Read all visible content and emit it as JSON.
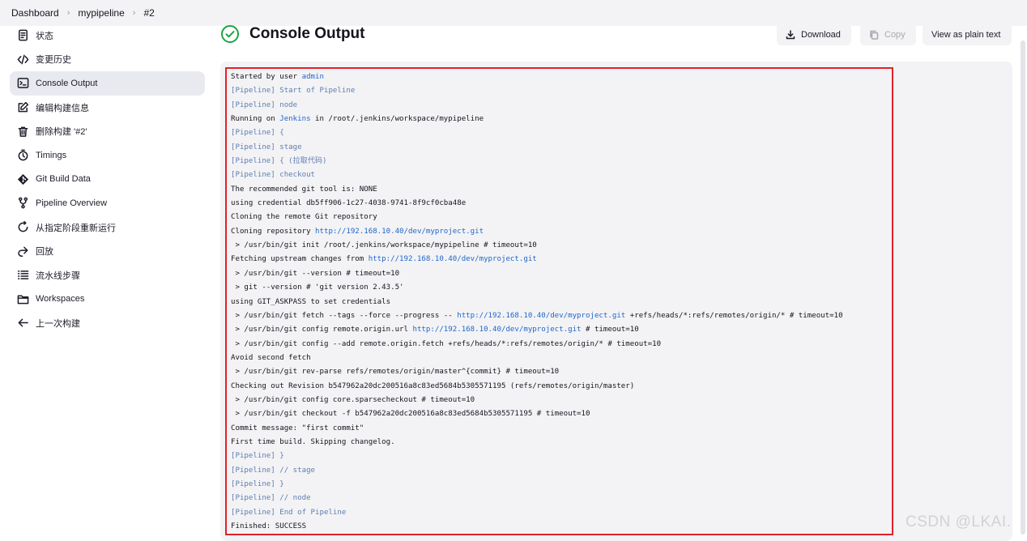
{
  "breadcrumb": {
    "items": [
      "Dashboard",
      "mypipeline",
      "#2"
    ]
  },
  "sidebar": {
    "items": [
      {
        "label": "状态",
        "icon": "document-icon",
        "active": false
      },
      {
        "label": "变更历史",
        "icon": "code-icon",
        "active": false
      },
      {
        "label": "Console Output",
        "icon": "terminal-icon",
        "active": true
      },
      {
        "label": "编辑构建信息",
        "icon": "edit-icon",
        "active": false
      },
      {
        "label": "删除构建 '#2'",
        "icon": "trash-icon",
        "active": false
      },
      {
        "label": "Timings",
        "icon": "stopwatch-icon",
        "active": false
      },
      {
        "label": "Git Build Data",
        "icon": "git-icon",
        "active": false
      },
      {
        "label": "Pipeline Overview",
        "icon": "pipeline-icon",
        "active": false
      },
      {
        "label": "从指定阶段重新运行",
        "icon": "restart-icon",
        "active": false
      },
      {
        "label": "回放",
        "icon": "replay-icon",
        "active": false
      },
      {
        "label": "流水线步骤",
        "icon": "list-icon",
        "active": false
      },
      {
        "label": "Workspaces",
        "icon": "folder-icon",
        "active": false
      },
      {
        "label": "上一次构建",
        "icon": "arrow-left-icon",
        "active": false
      }
    ]
  },
  "header": {
    "title": "Console Output",
    "status_icon": "success-check-icon"
  },
  "toolbar": {
    "download_label": "Download",
    "copy_label": "Copy",
    "plain_text_label": "View as plain text"
  },
  "console": {
    "lines": [
      [
        {
          "t": "Started by user "
        },
        {
          "t": "admin",
          "c": "lnk"
        }
      ],
      [
        {
          "t": "[Pipeline] Start of Pipeline",
          "c": "pl"
        }
      ],
      [
        {
          "t": "[Pipeline] node",
          "c": "pl"
        }
      ],
      [
        {
          "t": "Running on "
        },
        {
          "t": "Jenkins",
          "c": "lnk"
        },
        {
          "t": " in /root/.jenkins/workspace/mypipeline"
        }
      ],
      [
        {
          "t": "[Pipeline] {",
          "c": "pl"
        }
      ],
      [
        {
          "t": "[Pipeline] stage",
          "c": "pl"
        }
      ],
      [
        {
          "t": "[Pipeline] { (拉取代码)",
          "c": "pl"
        }
      ],
      [
        {
          "t": "[Pipeline] checkout",
          "c": "pl"
        }
      ],
      [
        {
          "t": "The recommended git tool is: NONE"
        }
      ],
      [
        {
          "t": "using credential db5ff906-1c27-4038-9741-8f9cf0cba48e"
        }
      ],
      [
        {
          "t": "Cloning the remote Git repository"
        }
      ],
      [
        {
          "t": "Cloning repository "
        },
        {
          "t": "http://192.168.10.40/dev/myproject.git",
          "c": "lnk"
        }
      ],
      [
        {
          "t": " > /usr/bin/git init /root/.jenkins/workspace/mypipeline # timeout=10"
        }
      ],
      [
        {
          "t": "Fetching upstream changes from "
        },
        {
          "t": "http://192.168.10.40/dev/myproject.git",
          "c": "lnk"
        }
      ],
      [
        {
          "t": " > /usr/bin/git --version # timeout=10"
        }
      ],
      [
        {
          "t": " > git --version # 'git version 2.43.5'"
        }
      ],
      [
        {
          "t": "using GIT_ASKPASS to set credentials"
        }
      ],
      [
        {
          "t": " > /usr/bin/git fetch --tags --force --progress -- "
        },
        {
          "t": "http://192.168.10.40/dev/myproject.git",
          "c": "lnk"
        },
        {
          "t": " +refs/heads/*:refs/remotes/origin/* # timeout=10"
        }
      ],
      [
        {
          "t": " > /usr/bin/git config remote.origin.url "
        },
        {
          "t": "http://192.168.10.40/dev/myproject.git",
          "c": "lnk"
        },
        {
          "t": " # timeout=10"
        }
      ],
      [
        {
          "t": " > /usr/bin/git config --add remote.origin.fetch +refs/heads/*:refs/remotes/origin/* # timeout=10"
        }
      ],
      [
        {
          "t": "Avoid second fetch"
        }
      ],
      [
        {
          "t": " > /usr/bin/git rev-parse refs/remotes/origin/master^{commit} # timeout=10"
        }
      ],
      [
        {
          "t": "Checking out Revision b547962a20dc200516a8c83ed5684b5305571195 (refs/remotes/origin/master)"
        }
      ],
      [
        {
          "t": " > /usr/bin/git config core.sparsecheckout # timeout=10"
        }
      ],
      [
        {
          "t": " > /usr/bin/git checkout -f b547962a20dc200516a8c83ed5684b5305571195 # timeout=10"
        }
      ],
      [
        {
          "t": "Commit message: \"first commit\""
        }
      ],
      [
        {
          "t": "First time build. Skipping changelog."
        }
      ],
      [
        {
          "t": "[Pipeline] }",
          "c": "pl"
        }
      ],
      [
        {
          "t": "[Pipeline] // stage",
          "c": "pl"
        }
      ],
      [
        {
          "t": "[Pipeline] }",
          "c": "pl"
        }
      ],
      [
        {
          "t": "[Pipeline] // node",
          "c": "pl"
        }
      ],
      [
        {
          "t": "[Pipeline] End of Pipeline",
          "c": "pl"
        }
      ],
      [
        {
          "t": "Finished: SUCCESS"
        }
      ]
    ]
  },
  "watermark": "CSDN @LKAI.",
  "colors": {
    "success": "#1ea446",
    "link": "#1f66c9",
    "pipeline": "#5f7db0",
    "highlight_border": "#e0222a"
  }
}
